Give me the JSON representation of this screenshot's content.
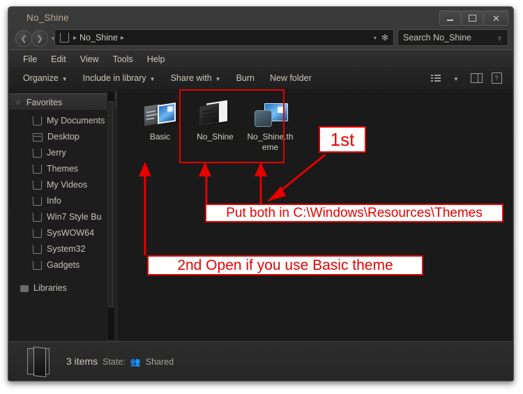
{
  "window": {
    "title": "No_Shine",
    "caption_buttons": [
      {
        "name": "minimize",
        "glyph": ""
      },
      {
        "name": "maximize",
        "glyph": ""
      },
      {
        "name": "close",
        "glyph": "✕"
      }
    ]
  },
  "address_bar": {
    "crumb_root_icon": "drive-icon",
    "crumb": "No_Shine",
    "separator": "▸",
    "dropdown_caret": "▾",
    "refresh_glyph": "✻"
  },
  "search": {
    "placeholder": "Search No_Shine",
    "icon": "magnifier-icon",
    "glyph": "⌕"
  },
  "menubar": {
    "items": [
      "File",
      "Edit",
      "View",
      "Tools",
      "Help"
    ]
  },
  "toolbar": {
    "items": [
      {
        "label": "Organize",
        "caret": true
      },
      {
        "label": "Include in library",
        "caret": true
      },
      {
        "label": "Share with",
        "caret": true
      },
      {
        "label": "Burn",
        "caret": false
      },
      {
        "label": "New folder",
        "caret": false
      }
    ],
    "right_icons": [
      "view-mode-icon",
      "view-caret-icon",
      "preview-pane-icon",
      "help-icon"
    ],
    "view_caret": "▾"
  },
  "nav_pane": {
    "favorites": {
      "label": "Favorites",
      "icon": "star-icon"
    },
    "items": [
      {
        "label": "My Documents",
        "icon": "folder-icon"
      },
      {
        "label": "Desktop",
        "icon": "desktop-icon"
      },
      {
        "label": "Jerry",
        "icon": "folder-icon"
      },
      {
        "label": "Themes",
        "icon": "folder-icon"
      },
      {
        "label": "My Videos",
        "icon": "folder-icon"
      },
      {
        "label": "Info",
        "icon": "folder-icon"
      },
      {
        "label": "Win7 Style Bu",
        "icon": "folder-icon"
      },
      {
        "label": "SysWOW64",
        "icon": "folder-icon"
      },
      {
        "label": "System32",
        "icon": "folder-icon"
      },
      {
        "label": "Gadgets",
        "icon": "folder-icon"
      }
    ],
    "libraries": {
      "label": "Libraries",
      "icon": "library-icon"
    }
  },
  "files": [
    {
      "name": "Basic",
      "icon": "theme-preview-icon",
      "selected": false
    },
    {
      "name": "No_Shine",
      "icon": "dark-theme-icon",
      "selected": true
    },
    {
      "name": "No_Shine.theme",
      "icon": "theme-file-icon",
      "selected": true
    }
  ],
  "status_bar": {
    "icon": "folder-large-icon",
    "items_count": "3 items",
    "state_label": "State:",
    "state_icon": "share-icon",
    "state_value": "Shared"
  },
  "annotations": {
    "first": "1st",
    "put_both": "Put both in C:\\Windows\\Resources\\Themes",
    "second": "2nd Open if you use Basic theme"
  },
  "colors": {
    "annotation_red": "#e60000",
    "annotation_text": "#ec0000",
    "annotation_bg": "#ffffff",
    "window_bg": "#2b2b2b",
    "content_bg": "#1a1a1a",
    "nav_bg": "#1d1d1d",
    "title_text": "#b9a98e",
    "body_text": "#cfc9bd"
  }
}
